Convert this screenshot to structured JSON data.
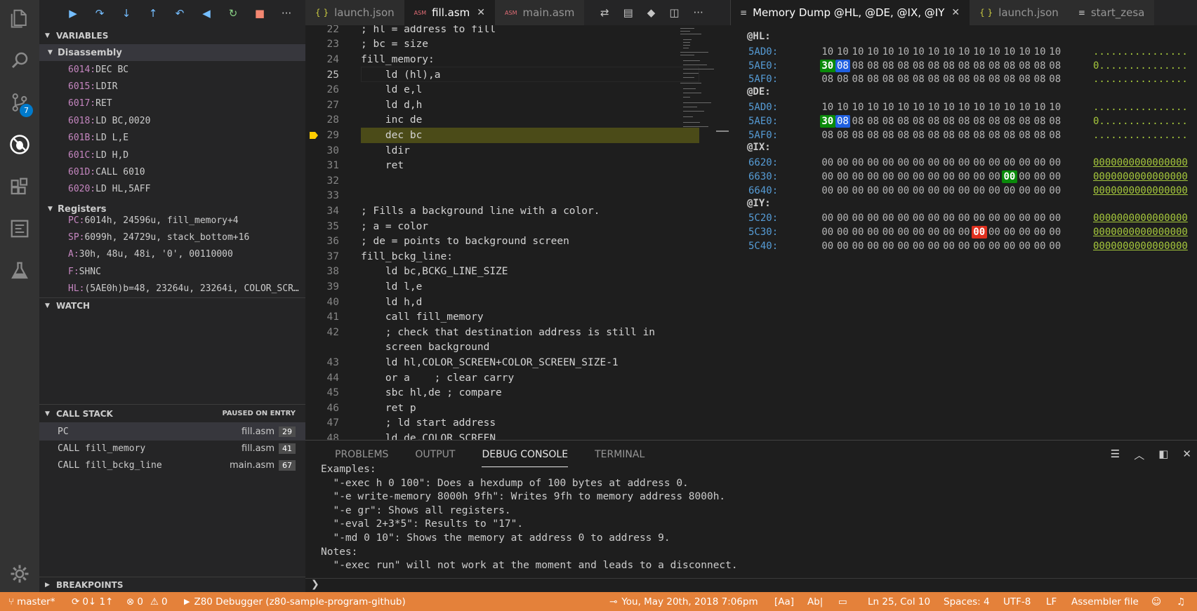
{
  "debug_toolbar": [
    "continue",
    "step-over",
    "step-into",
    "step-out",
    "step-back",
    "reverse-continue",
    "restart",
    "stop",
    "more"
  ],
  "tabs_left": [
    {
      "icon": "{ }",
      "label": "launch.json",
      "active": false
    },
    {
      "icon": "ASM",
      "label": "fill.asm",
      "active": true
    },
    {
      "icon": "ASM",
      "label": "main.asm",
      "active": false
    }
  ],
  "tabs_right": [
    {
      "icon": "≡",
      "label": "Memory Dump @HL, @DE, @IX, @IY",
      "active": true
    },
    {
      "icon": "{ }",
      "label": "launch.json",
      "active": false
    },
    {
      "icon": "≡",
      "label": "start_zesa",
      "active": false
    }
  ],
  "sidebar": {
    "variables_title": "VARIABLES",
    "disassembly_title": "Disassembly",
    "disassembly": [
      {
        "addr": "6014:",
        "instr": "DEC BC"
      },
      {
        "addr": "6015:",
        "instr": "LDIR"
      },
      {
        "addr": "6017:",
        "instr": "RET"
      },
      {
        "addr": "6018:",
        "instr": "LD BC,0020"
      },
      {
        "addr": "601B:",
        "instr": "LD L,E"
      },
      {
        "addr": "601C:",
        "instr": "LD H,D"
      },
      {
        "addr": "601D:",
        "instr": "CALL 6010"
      },
      {
        "addr": "6020:",
        "instr": "LD HL,5AFF"
      }
    ],
    "registers_title": "Registers",
    "registers": [
      {
        "name": "PC:",
        "value": "6014h, 24596u, fill_memory+4"
      },
      {
        "name": "SP:",
        "value": "6099h, 24729u, stack_bottom+16"
      },
      {
        "name": "A:",
        "value": "30h, 48u, 48i, '0', 00110000"
      },
      {
        "name": "F:",
        "value": "SHNC"
      },
      {
        "name": "HL:",
        "value": "(5AE0h)b=48, 23264u, 23264i, COLOR_SCR…"
      }
    ],
    "watch_title": "WATCH",
    "callstack_title": "CALL STACK",
    "callstack_state": "PAUSED ON ENTRY",
    "callstack": [
      {
        "fn": "PC",
        "file": "fill.asm",
        "line": "29"
      },
      {
        "fn": "CALL fill_memory",
        "file": "fill.asm",
        "line": "41"
      },
      {
        "fn": "CALL fill_bckg_line",
        "file": "main.asm",
        "line": "67"
      }
    ],
    "breakpoints_title": "BREAKPOINTS",
    "scm_badge": "7"
  },
  "editor": {
    "current_line": 25,
    "breakpoint_line": 29,
    "lines": [
      {
        "n": "22",
        "text": "; hl = address to fill"
      },
      {
        "n": "23",
        "text": "; bc = size"
      },
      {
        "n": "24",
        "text": "fill_memory:"
      },
      {
        "n": "25",
        "text": "    ld (hl),a"
      },
      {
        "n": "26",
        "text": "    ld e,l"
      },
      {
        "n": "27",
        "text": "    ld d,h"
      },
      {
        "n": "28",
        "text": "    inc de"
      },
      {
        "n": "29",
        "text": "    dec bc"
      },
      {
        "n": "30",
        "text": "    ldir"
      },
      {
        "n": "31",
        "text": "    ret"
      },
      {
        "n": "32",
        "text": ""
      },
      {
        "n": "33",
        "text": ""
      },
      {
        "n": "34",
        "text": "; Fills a background line with a color."
      },
      {
        "n": "35",
        "text": "; a = color"
      },
      {
        "n": "36",
        "text": "; de = points to background screen"
      },
      {
        "n": "37",
        "text": "fill_bckg_line:"
      },
      {
        "n": "38",
        "text": "    ld bc,BCKG_LINE_SIZE"
      },
      {
        "n": "39",
        "text": "    ld l,e"
      },
      {
        "n": "40",
        "text": "    ld h,d"
      },
      {
        "n": "41",
        "text": "    call fill_memory"
      },
      {
        "n": "42",
        "text": "    ; check that destination address is still in"
      },
      {
        "n": "",
        "text": "    screen background"
      },
      {
        "n": "43",
        "text": "    ld hl,COLOR_SCREEN+COLOR_SCREEN_SIZE-1"
      },
      {
        "n": "44",
        "text": "    or a    ; clear carry"
      },
      {
        "n": "45",
        "text": "    sbc hl,de ; compare"
      },
      {
        "n": "46",
        "text": "    ret p"
      },
      {
        "n": "47",
        "text": "    ; ld start address"
      },
      {
        "n": "48",
        "text": "    ld de,COLOR_SCREEN"
      }
    ]
  },
  "memory": {
    "groups": [
      {
        "label": "@HL:",
        "rows": [
          {
            "addr": "5AD0:",
            "bytes": [
              "10",
              "10",
              "10",
              "10",
              "10",
              "10",
              "10",
              "10",
              "10",
              "10",
              "10",
              "10",
              "10",
              "10",
              "10",
              "10"
            ],
            "marks": {},
            "ascii": "................",
            "ul": false
          },
          {
            "addr": "5AE0:",
            "bytes": [
              "30",
              "08",
              "08",
              "08",
              "08",
              "08",
              "08",
              "08",
              "08",
              "08",
              "08",
              "08",
              "08",
              "08",
              "08",
              "08"
            ],
            "marks": {
              "0": "g",
              "1": "b"
            },
            "ascii": "0...............",
            "ul": false
          },
          {
            "addr": "5AF0:",
            "bytes": [
              "08",
              "08",
              "08",
              "08",
              "08",
              "08",
              "08",
              "08",
              "08",
              "08",
              "08",
              "08",
              "08",
              "08",
              "08",
              "08"
            ],
            "marks": {},
            "ascii": "................",
            "ul": false
          }
        ]
      },
      {
        "label": "@DE:",
        "rows": [
          {
            "addr": "5AD0:",
            "bytes": [
              "10",
              "10",
              "10",
              "10",
              "10",
              "10",
              "10",
              "10",
              "10",
              "10",
              "10",
              "10",
              "10",
              "10",
              "10",
              "10"
            ],
            "marks": {},
            "ascii": "................",
            "ul": false
          },
          {
            "addr": "5AE0:",
            "bytes": [
              "30",
              "08",
              "08",
              "08",
              "08",
              "08",
              "08",
              "08",
              "08",
              "08",
              "08",
              "08",
              "08",
              "08",
              "08",
              "08"
            ],
            "marks": {
              "0": "g",
              "1": "b"
            },
            "ascii": "0...............",
            "ul": false
          },
          {
            "addr": "5AF0:",
            "bytes": [
              "08",
              "08",
              "08",
              "08",
              "08",
              "08",
              "08",
              "08",
              "08",
              "08",
              "08",
              "08",
              "08",
              "08",
              "08",
              "08"
            ],
            "marks": {},
            "ascii": "................",
            "ul": false
          }
        ]
      },
      {
        "label": "@IX:",
        "rows": [
          {
            "addr": "6620:",
            "bytes": [
              "00",
              "00",
              "00",
              "00",
              "00",
              "00",
              "00",
              "00",
              "00",
              "00",
              "00",
              "00",
              "00",
              "00",
              "00",
              "00"
            ],
            "marks": {},
            "ascii": "0000000000000000",
            "ul": true
          },
          {
            "addr": "6630:",
            "bytes": [
              "00",
              "00",
              "00",
              "00",
              "00",
              "00",
              "00",
              "00",
              "00",
              "00",
              "00",
              "00",
              "00",
              "00",
              "00",
              "00"
            ],
            "marks": {
              "12": "g"
            },
            "ascii": "0000000000000000",
            "ul": true
          },
          {
            "addr": "6640:",
            "bytes": [
              "00",
              "00",
              "00",
              "00",
              "00",
              "00",
              "00",
              "00",
              "00",
              "00",
              "00",
              "00",
              "00",
              "00",
              "00",
              "00"
            ],
            "marks": {},
            "ascii": "0000000000000000",
            "ul": true
          }
        ]
      },
      {
        "label": "@IY:",
        "rows": [
          {
            "addr": "5C20:",
            "bytes": [
              "00",
              "00",
              "00",
              "00",
              "00",
              "00",
              "00",
              "00",
              "00",
              "00",
              "00",
              "00",
              "00",
              "00",
              "00",
              "00"
            ],
            "marks": {},
            "ascii": "0000000000000000",
            "ul": true
          },
          {
            "addr": "5C30:",
            "bytes": [
              "00",
              "00",
              "00",
              "00",
              "00",
              "00",
              "00",
              "00",
              "00",
              "00",
              "00",
              "00",
              "00",
              "00",
              "00",
              "00"
            ],
            "marks": {
              "10": "r"
            },
            "ascii": "0000000000000000",
            "ul": true
          },
          {
            "addr": "5C40:",
            "bytes": [
              "00",
              "00",
              "00",
              "00",
              "00",
              "00",
              "00",
              "00",
              "00",
              "00",
              "00",
              "00",
              "00",
              "00",
              "00",
              "00"
            ],
            "marks": {},
            "ascii": "0000000000000000",
            "ul": true
          }
        ]
      }
    ]
  },
  "panel": {
    "tabs": [
      "PROBLEMS",
      "OUTPUT",
      "DEBUG CONSOLE",
      "TERMINAL"
    ],
    "active_tab": "DEBUG CONSOLE",
    "console": [
      "Examples:",
      "  \"-exec h 0 100\": Does a hexdump of 100 bytes at address 0.",
      "  \"-e write-memory 8000h 9fh\": Writes 9fh to memory address 8000h.",
      "  \"-e gr\": Shows all registers.",
      "  \"-eval 2+3*5\": Results to \"17\".",
      "  \"-md 0 10\": Shows the memory at address 0 to address 9.",
      "Notes:",
      "  \"-exec run\" will not work at the moment and leads to a disconnect."
    ],
    "prompt": "❯"
  },
  "status": {
    "branch": "master*",
    "sync": "0↓ 1↑",
    "errors": "0",
    "warnings": "0",
    "debug_target": "Z80 Debugger (z80-sample-program-github)",
    "datetime": "You, May 20th, 2018 7:06pm",
    "match_case": "[Aa]",
    "whole_word": "Ab|",
    "position": "Ln 25, Col 10",
    "spaces": "Spaces: 4",
    "encoding": "UTF-8",
    "eol": "LF",
    "language": "Assembler file",
    "colors": {
      "bar": "#e4813a"
    }
  }
}
